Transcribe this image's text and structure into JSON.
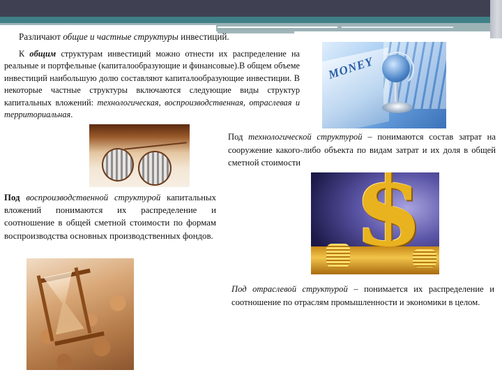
{
  "slide": {
    "intro": {
      "prefix": "Различают ",
      "emphasis": "общие и частные структуры",
      "suffix": " инвестиций."
    },
    "general": {
      "lead": "К ",
      "term": "общим",
      "body": " структурам инвестиций можно отнести их распределение на реальные и портфельные (капиталообразующие и финансовые).В общем объеме инвестиций наибольшую долю составляют капиталообразующие инвестиции. В некоторые частные структуры включаются следующие виды структур капитальных вложений: ",
      "types": "технологическая, воспроизводственная, отраслевая и",
      "types_last": "территориальная",
      "end": "."
    },
    "technological": {
      "lead": "Под ",
      "term": "технологической структурой",
      "body": " – понимаются состав затрат на сооружение какого-либо объекта по видам затрат и их доля в общей сметной стоимости"
    },
    "reproductive": {
      "lead": "Под ",
      "term": "воспроизводственной структурой",
      "body": " капитальных вложений понимаются их распределение и соотношение в общей сметной стоимости по формам воспроизводства основных производственных фондов."
    },
    "industry": {
      "term": "Под отраслевой структурой",
      "body": " – понимается их распределение и соотношение по отраслям промышленности и экономики в целом."
    },
    "images": {
      "money": "MONEY",
      "dollar": "$"
    }
  }
}
